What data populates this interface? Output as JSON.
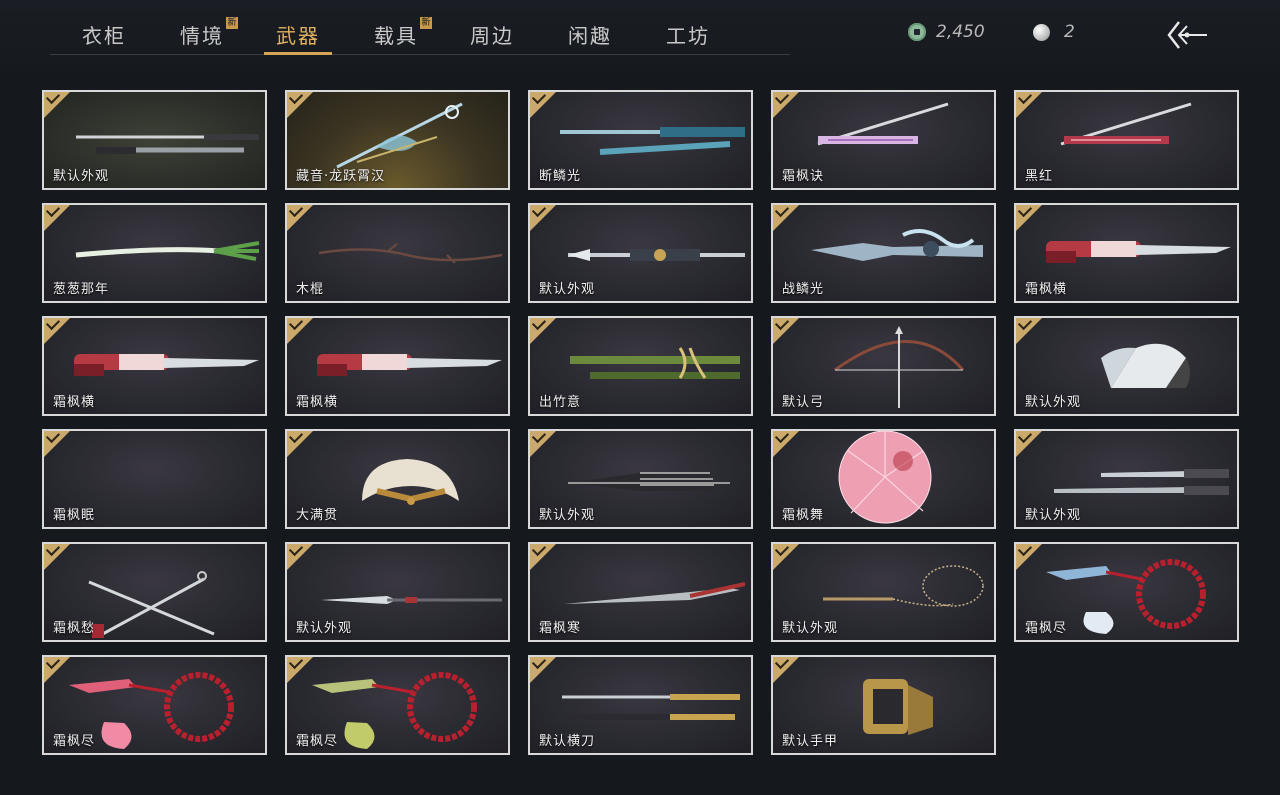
{
  "tabs": [
    {
      "label": "衣柜",
      "new": false,
      "active": false
    },
    {
      "label": "情境",
      "new": true,
      "active": false
    },
    {
      "label": "武器",
      "new": false,
      "active": true
    },
    {
      "label": "载具",
      "new": true,
      "active": false
    },
    {
      "label": "周边",
      "new": false,
      "active": false
    },
    {
      "label": "闲趣",
      "new": false,
      "active": false
    },
    {
      "label": "工坊",
      "new": false,
      "active": false
    }
  ],
  "new_badge": "新",
  "currency": {
    "coins": "2,450",
    "pearls": "2",
    "coin_icon": "jade-coin-icon",
    "pearl_icon": "pearl-icon"
  },
  "back_icon": "back-arrow-icon",
  "colors": {
    "accent": "#e2b160",
    "check": "#caa96a",
    "card_border": "#d8d8d8"
  },
  "items": [
    {
      "name": "默认外观",
      "art": "sword-pair",
      "bg": "green"
    },
    {
      "name": "藏音·龙跃霄汉",
      "art": "ornate-sword",
      "bg": "gold"
    },
    {
      "name": "断鳞光",
      "art": "blue-sword",
      "bg": ""
    },
    {
      "name": "霜枫诀",
      "art": "pink-sword",
      "bg": ""
    },
    {
      "name": "黑红",
      "art": "red-sword",
      "bg": ""
    },
    {
      "name": "葱葱那年",
      "art": "scallion",
      "bg": ""
    },
    {
      "name": "木棍",
      "art": "stick",
      "bg": ""
    },
    {
      "name": "默认外观",
      "art": "spear",
      "bg": ""
    },
    {
      "name": "战鳞光",
      "art": "dragon-spear",
      "bg": ""
    },
    {
      "name": "霜枫横",
      "art": "red-blade",
      "bg": ""
    },
    {
      "name": "霜枫横",
      "art": "red-blade",
      "bg": ""
    },
    {
      "name": "霜枫横",
      "art": "red-blade",
      "bg": ""
    },
    {
      "name": "出竹意",
      "art": "bamboo",
      "bg": ""
    },
    {
      "name": "默认弓",
      "art": "bow",
      "bg": ""
    },
    {
      "name": "默认外观",
      "art": "white-fan",
      "bg": ""
    },
    {
      "name": "霜枫眠",
      "art": "none",
      "bg": ""
    },
    {
      "name": "大满贯",
      "art": "gold-fan",
      "bg": ""
    },
    {
      "name": "默认外观",
      "art": "black-umbrella",
      "bg": ""
    },
    {
      "name": "霜枫舞",
      "art": "pink-umbrella",
      "bg": ""
    },
    {
      "name": "默认外观",
      "art": "twin-blades",
      "bg": ""
    },
    {
      "name": "霜枫愁",
      "art": "crossed-blades",
      "bg": ""
    },
    {
      "name": "默认外观",
      "art": "glaive",
      "bg": ""
    },
    {
      "name": "霜枫寒",
      "art": "long-blade",
      "bg": ""
    },
    {
      "name": "默认外观",
      "art": "rope-dart",
      "bg": ""
    },
    {
      "name": "霜枫尽",
      "art": "beads-blue",
      "bg": ""
    },
    {
      "name": "霜枫尽",
      "art": "beads-red",
      "bg": ""
    },
    {
      "name": "霜枫尽",
      "art": "beads-green",
      "bg": ""
    },
    {
      "name": "默认横刀",
      "art": "katana",
      "bg": ""
    },
    {
      "name": "默认手甲",
      "art": "gauntlet",
      "bg": ""
    }
  ]
}
